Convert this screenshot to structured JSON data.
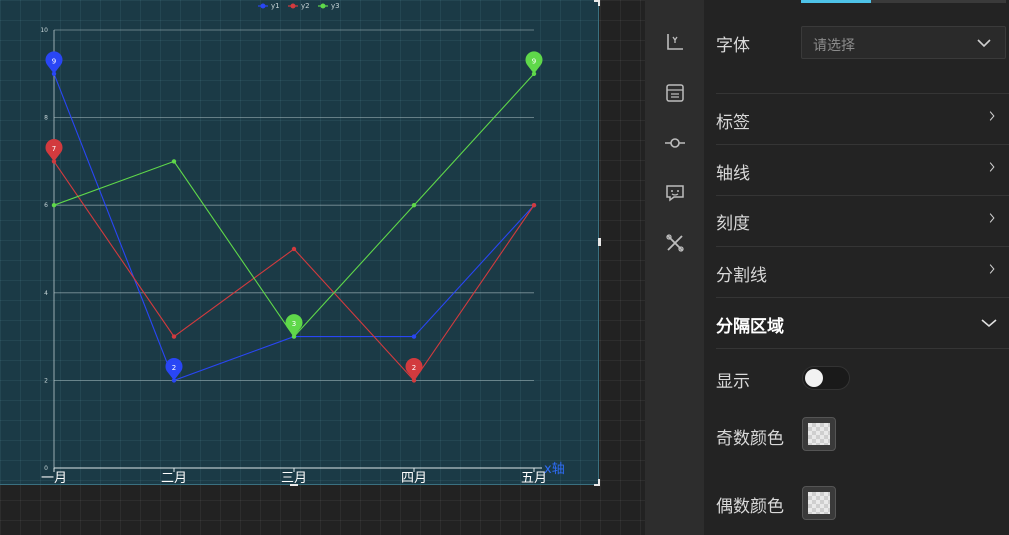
{
  "chart_data": {
    "type": "line",
    "categories": [
      "一月",
      "二月",
      "三月",
      "四月",
      "五月"
    ],
    "series": [
      {
        "name": "y1",
        "color": "#2946f5",
        "values": [
          9,
          2,
          3,
          3,
          6
        ]
      },
      {
        "name": "y2",
        "color": "#d23a3e",
        "values": [
          7,
          3,
          5,
          2,
          6
        ]
      },
      {
        "name": "y3",
        "color": "#5fd84a",
        "values": [
          6,
          7,
          3,
          6,
          9
        ]
      }
    ],
    "markers": [
      {
        "series": 0,
        "index": 0,
        "label": "9"
      },
      {
        "series": 0,
        "index": 1,
        "label": "2"
      },
      {
        "series": 1,
        "index": 0,
        "label": "7"
      },
      {
        "series": 1,
        "index": 3,
        "label": "2"
      },
      {
        "series": 2,
        "index": 2,
        "label": "3"
      },
      {
        "series": 2,
        "index": 4,
        "label": "9"
      }
    ],
    "yticks": [
      0,
      2,
      4,
      6,
      8,
      10
    ],
    "ylim": [
      0,
      10
    ],
    "xaxis_name": "x轴",
    "legend_position": "top-center",
    "grid": true
  },
  "icons": [
    "axis-icon",
    "data-list-icon",
    "node-icon",
    "tooltip-icon",
    "tools-icon"
  ],
  "panel": {
    "font_label": "字体",
    "font_placeholder": "请选择",
    "sections": [
      "标签",
      "轴线",
      "刻度",
      "分割线"
    ],
    "expanded_section": "分隔区域",
    "show_label": "显示",
    "show_enabled": false,
    "odd_color_label": "奇数颜色",
    "even_color_label": "偶数颜色"
  }
}
